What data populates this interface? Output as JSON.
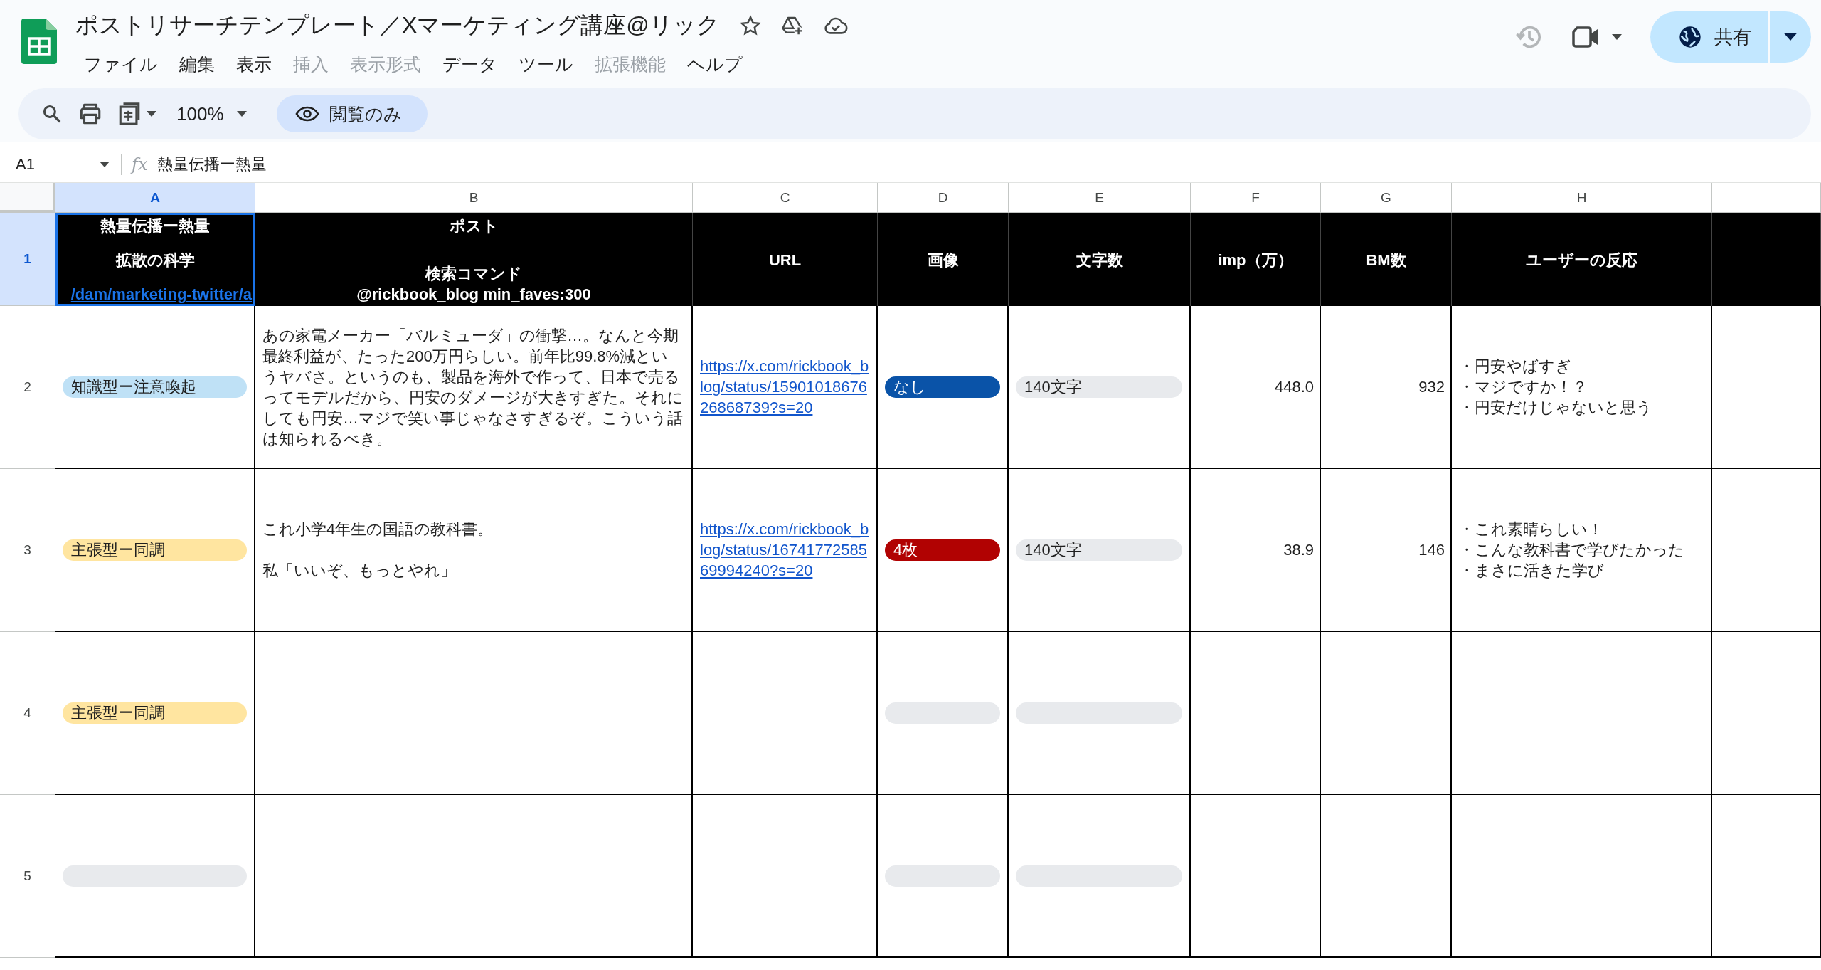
{
  "app": {
    "title": "ポストリサーチテンプレート／Xマーケティング講座@リック",
    "share_label": "共有"
  },
  "menus": [
    {
      "label": "ファイル",
      "disabled": false
    },
    {
      "label": "編集",
      "disabled": false
    },
    {
      "label": "表示",
      "disabled": false
    },
    {
      "label": "挿入",
      "disabled": true
    },
    {
      "label": "表示形式",
      "disabled": true
    },
    {
      "label": "データ",
      "disabled": false
    },
    {
      "label": "ツール",
      "disabled": false
    },
    {
      "label": "拡張機能",
      "disabled": true
    },
    {
      "label": "ヘルプ",
      "disabled": false
    }
  ],
  "toolbar": {
    "zoom": "100%",
    "mode": "閲覧のみ"
  },
  "formula_bar": {
    "cell_ref": "A1",
    "function_label": "fx",
    "formula": "熱量伝播ー熱量"
  },
  "columns": [
    {
      "label": "A",
      "selected": true
    },
    {
      "label": "B",
      "selected": false
    },
    {
      "label": "C",
      "selected": false
    },
    {
      "label": "D",
      "selected": false
    },
    {
      "label": "E",
      "selected": false
    },
    {
      "label": "F",
      "selected": false
    },
    {
      "label": "G",
      "selected": false
    },
    {
      "label": "H",
      "selected": false
    }
  ],
  "header_row": {
    "row_number": "1",
    "selected": true,
    "cells": [
      {
        "lines": [
          "熱量伝播ー熱量",
          "拡散の科学"
        ],
        "link": "/dam/marketing-twitter/a"
      },
      {
        "lines": [
          "ポスト",
          "検索コマンド",
          "@rickbook_blog min_faves:300"
        ]
      },
      {
        "lines": [
          "URL"
        ]
      },
      {
        "lines": [
          "画像"
        ]
      },
      {
        "lines": [
          "文字数"
        ]
      },
      {
        "lines": [
          "imp（万）"
        ]
      },
      {
        "lines": [
          "BM数"
        ]
      },
      {
        "lines": [
          "ユーザーの反応"
        ]
      }
    ]
  },
  "rows": [
    {
      "row_number": "2",
      "tag": {
        "text": "知識型ー注意喚起",
        "color": "#bfe1f6"
      },
      "post": [
        "あの家電メーカー「バルミューダ」の衝撃…。なんと今期最終利益が、たった200万円らしい。前年比99.8%減というヤバさ。というのも、製品を海外で作って、日本で売るってモデルだから、円安のダメージが大きすぎた。それにしても円安…マジで笑い事じゃなさすぎるぞ。こういう話は知られるべき。"
      ],
      "url": "https://x.com/rickbook_blog/status/1590101867626868739?s=20",
      "image": {
        "text": "なし",
        "color": "#0a53a8"
      },
      "length": {
        "text": "140文字",
        "color": "#e8eaed"
      },
      "imp": "448.0",
      "bm": "932",
      "reactions": [
        "・円安やばすぎ",
        "・マジですか！？",
        "・円安だけじゃないと思う"
      ]
    },
    {
      "row_number": "3",
      "tag": {
        "text": "主張型ー同調",
        "color": "#ffe5a0"
      },
      "post": [
        "これ小学4年生の国語の教科書。",
        "私「いいぞ、もっとやれ」"
      ],
      "url": "https://x.com/rickbook_blog/status/1674177258569994240?s=20",
      "image": {
        "text": "4枚",
        "color": "#b10202"
      },
      "length": {
        "text": "140文字",
        "color": "#e8eaed"
      },
      "imp": "38.9",
      "bm": "146",
      "reactions": [
        "・これ素晴らしい！",
        "・こんな教科書で学びたかった",
        "・まさに活きた学び"
      ]
    },
    {
      "row_number": "4",
      "tag": {
        "text": "主張型ー同調",
        "color": "#ffe5a0"
      },
      "image": {
        "color": "#e8eaed"
      },
      "length": {
        "color": "#e8eaed"
      }
    },
    {
      "row_number": "5",
      "tag": {
        "color": "#e8eaed"
      },
      "image": {
        "color": "#e8eaed"
      },
      "length": {
        "color": "#e8eaed"
      }
    }
  ]
}
